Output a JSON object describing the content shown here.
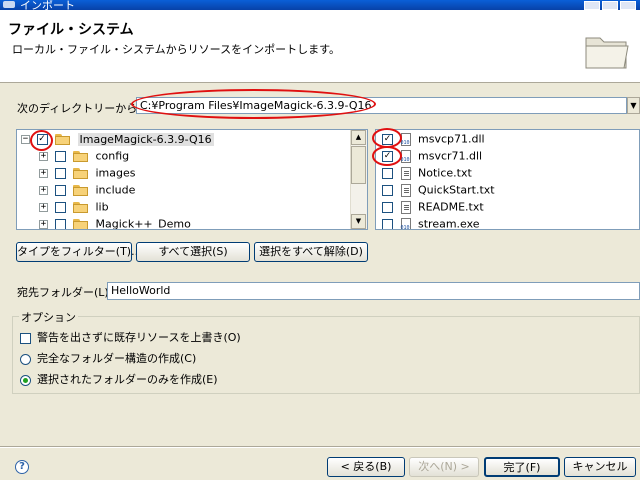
{
  "window": {
    "title": "インポート"
  },
  "header": {
    "title": "ファイル・システム",
    "description": "ローカル・ファイル・システムからリソースをインポートします。"
  },
  "source": {
    "label": "次のディレクトリーから(Y):",
    "value": "C:¥Program Files¥ImageMagick-6.3.9-Q16"
  },
  "tree": {
    "items": [
      {
        "label": "ImageMagick-6.3.9-Q16",
        "checked": true,
        "expander": "−",
        "selected": true
      },
      {
        "label": "config",
        "checked": false,
        "expander": "+"
      },
      {
        "label": "images",
        "checked": false,
        "expander": "+"
      },
      {
        "label": "include",
        "checked": false,
        "expander": "+"
      },
      {
        "label": "lib",
        "checked": false,
        "expander": "+"
      },
      {
        "label": "Magick++_Demo",
        "checked": false,
        "expander": "+"
      }
    ]
  },
  "files": {
    "items": [
      {
        "label": "msvcp71.dll",
        "checked": true,
        "icon": "binary-file-icon"
      },
      {
        "label": "msvcr71.dll",
        "checked": true,
        "icon": "binary-file-icon"
      },
      {
        "label": "Notice.txt",
        "checked": false,
        "icon": "text-file-icon"
      },
      {
        "label": "QuickStart.txt",
        "checked": false,
        "icon": "text-file-icon"
      },
      {
        "label": "README.txt",
        "checked": false,
        "icon": "text-file-icon"
      },
      {
        "label": "stream.exe",
        "checked": false,
        "icon": "binary-file-icon"
      }
    ]
  },
  "buttons": {
    "filter": "タイプをフィルター(T)...",
    "select_all": "すべて選択(S)",
    "deselect_all": "選択をすべて解除(D)"
  },
  "destination": {
    "label": "宛先フォルダー(L):",
    "value": "HelloWorld"
  },
  "options": {
    "legend": "オプション",
    "overwrite": {
      "label": "警告を出さずに既存リソースを上書き(O)",
      "checked": false
    },
    "full_structure": {
      "label": "完全なフォルダー構造の作成(C)",
      "selected": false
    },
    "selected_only": {
      "label": "選択されたフォルダーのみを作成(E)",
      "selected": true
    }
  },
  "footer": {
    "back": "< 戻る(B)",
    "next": "次へ(N) >",
    "finish": "完了(F)",
    "cancel": "キャンセル"
  },
  "colors": {
    "annotation": "#e01010",
    "selection": "#e0e0e0"
  }
}
